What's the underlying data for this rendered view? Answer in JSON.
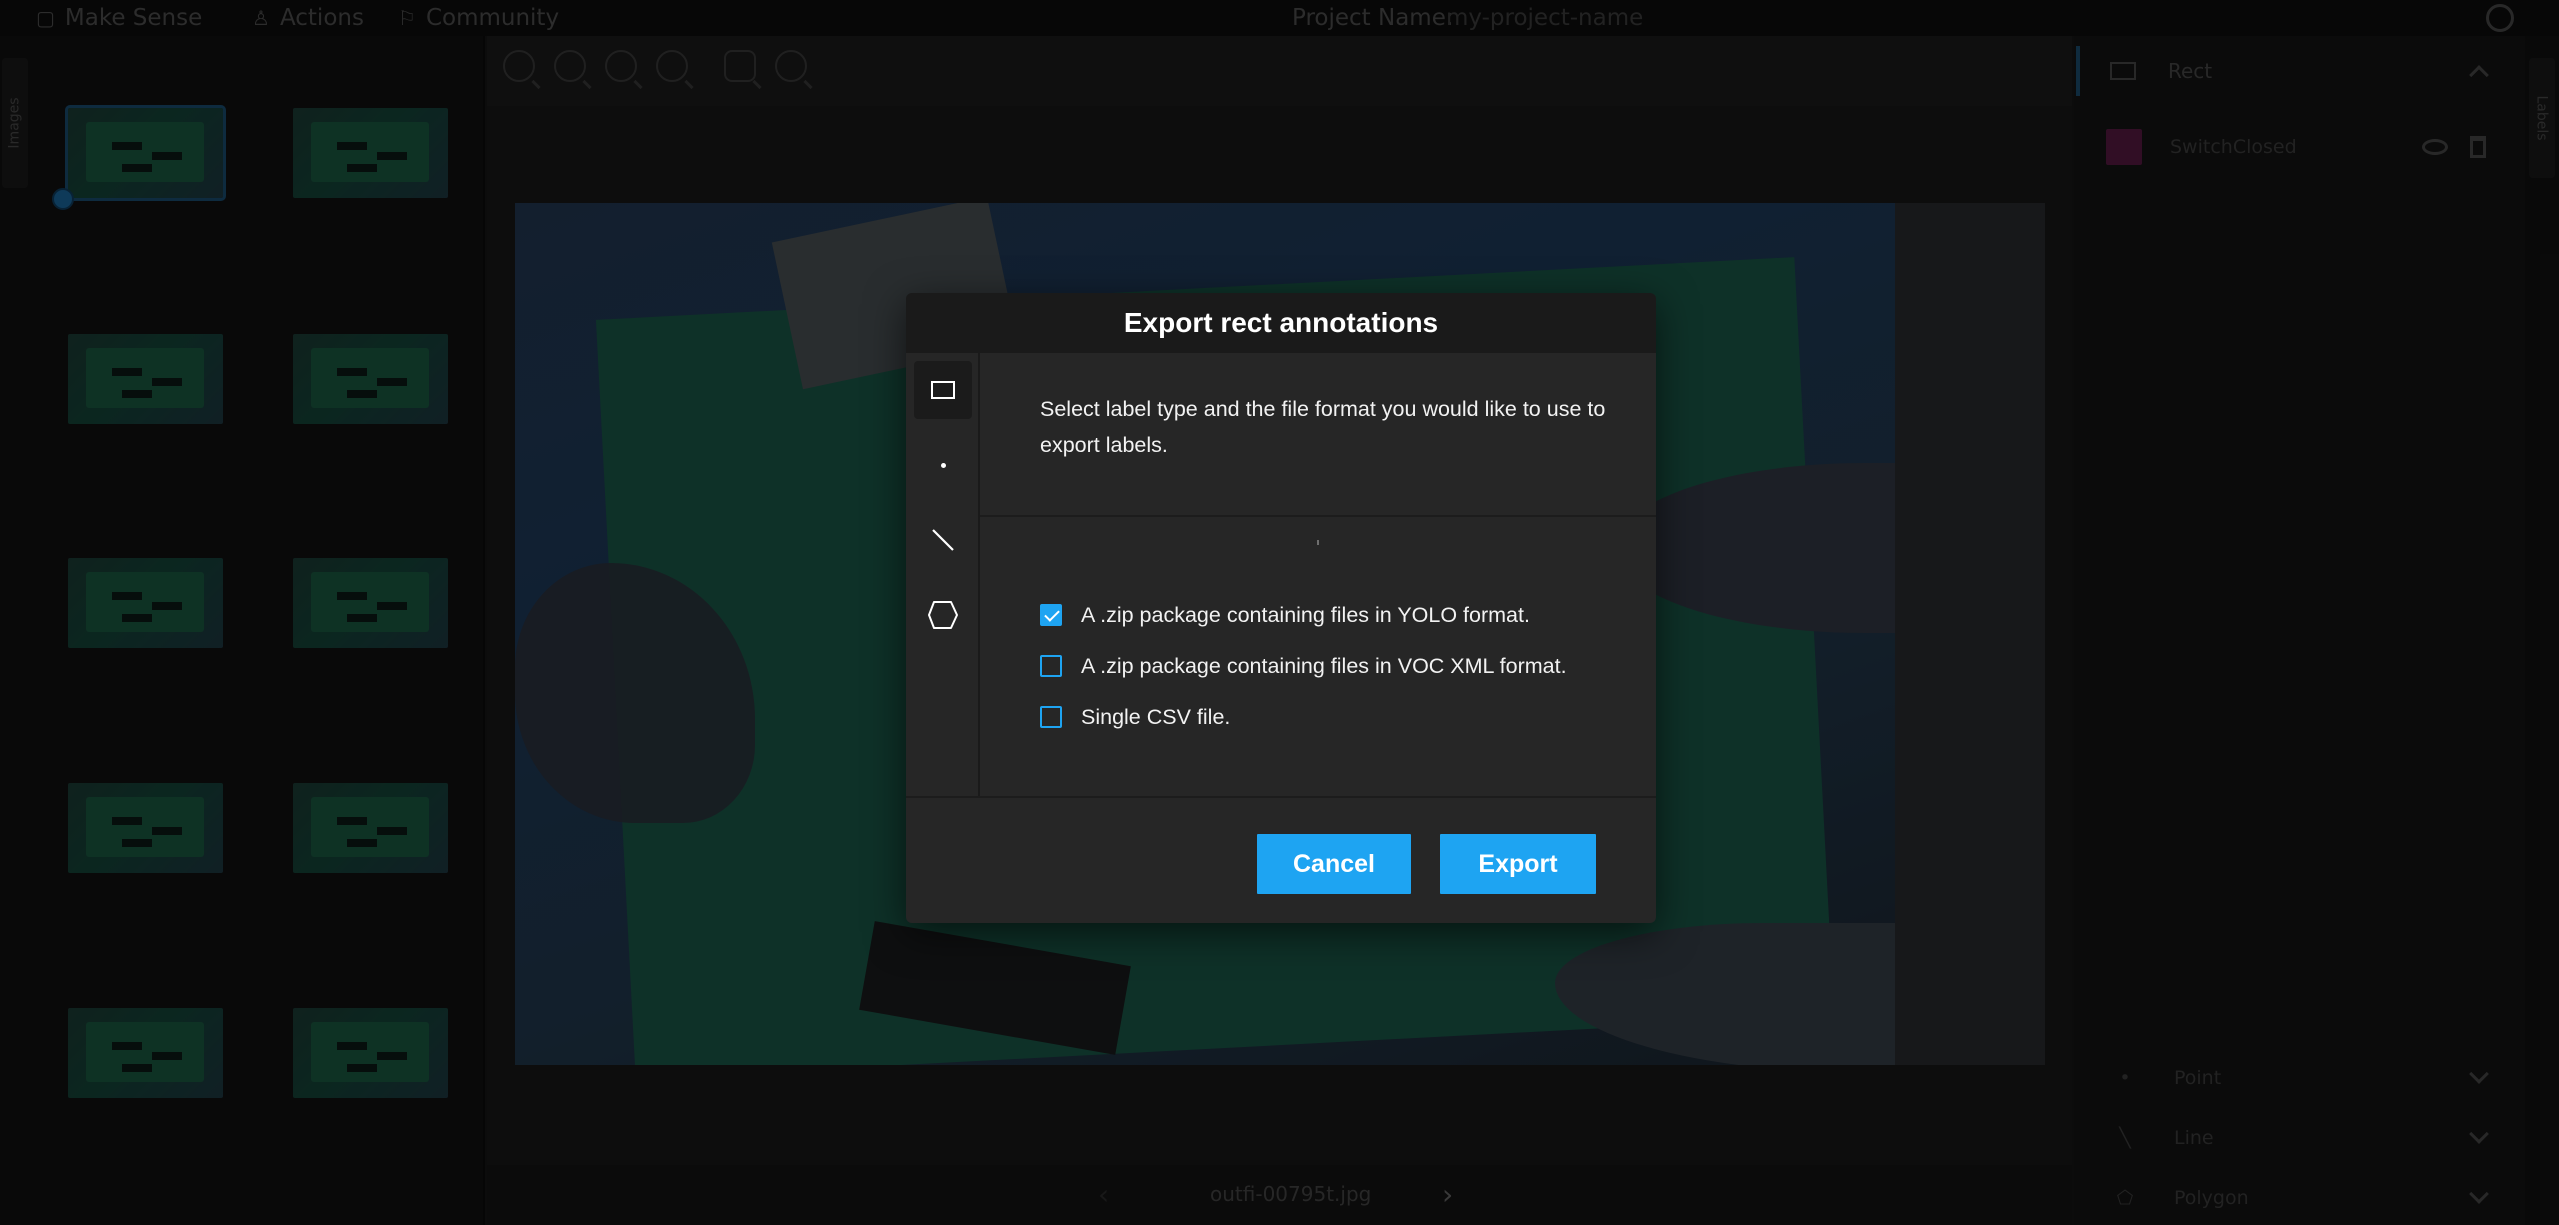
{
  "topbar": {
    "app_name": "Make Sense",
    "actions": "Actions",
    "community": "Community",
    "project_label": "Project Name:",
    "project_value": "my-project-name"
  },
  "left_rail": {
    "tab_label": "Images"
  },
  "editor": {
    "file_name": "outfi-00795t.jpg",
    "prev_arrow": "‹",
    "next_arrow": "›"
  },
  "right_rail": {
    "tab_label": "Labels"
  },
  "right_panel": {
    "header": "Rect",
    "labels": [
      {
        "name": "SwitchClosed",
        "color": "#b01e82"
      }
    ],
    "bottom": [
      {
        "name": "Point"
      },
      {
        "name": "Line"
      },
      {
        "name": "Polygon"
      }
    ]
  },
  "modal": {
    "title": "Export rect annotations",
    "description": "Select label type and the file format you would like to use to export labels.",
    "label_types": [
      "rect-icon",
      "point-icon",
      "line-icon",
      "polygon-icon"
    ],
    "options": [
      {
        "label": "A .zip package containing files in YOLO format.",
        "checked": true
      },
      {
        "label": "A .zip package containing files in VOC XML format.",
        "checked": false
      },
      {
        "label": "Single CSV file.",
        "checked": false
      }
    ],
    "cancel_label": "Cancel",
    "export_label": "Export",
    "accent_color": "#1ea4f2"
  }
}
